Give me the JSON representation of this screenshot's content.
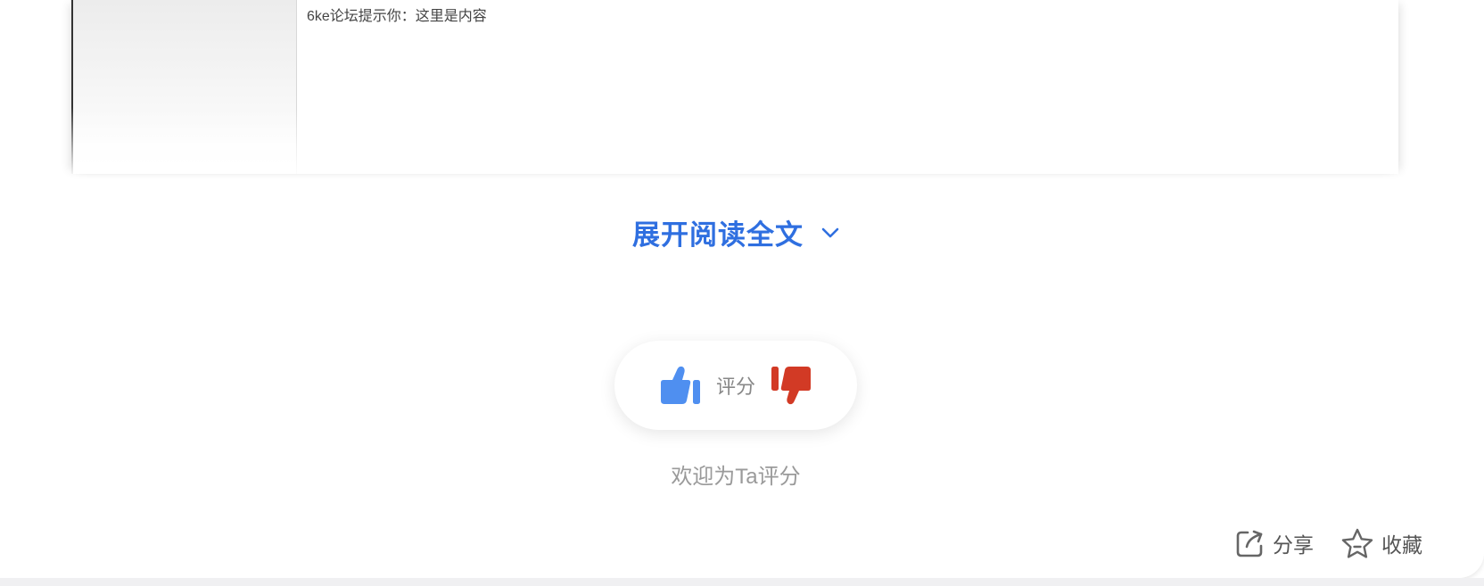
{
  "post": {
    "content_text": "6ke论坛提示你：这里是内容"
  },
  "expand": {
    "label": "展开阅读全文",
    "icon": "chevron-down-icon",
    "color": "#2f6fe0"
  },
  "rating": {
    "label": "评分",
    "like_icon": "thumbs-up-icon",
    "dislike_icon": "thumbs-down-icon",
    "like_color": "#4f8ff0",
    "dislike_color": "#d23a25",
    "prompt": "欢迎为Ta评分"
  },
  "actions": {
    "share_label": "分享",
    "share_icon": "share-icon",
    "favorite_label": "收藏",
    "favorite_icon": "star-icon"
  }
}
